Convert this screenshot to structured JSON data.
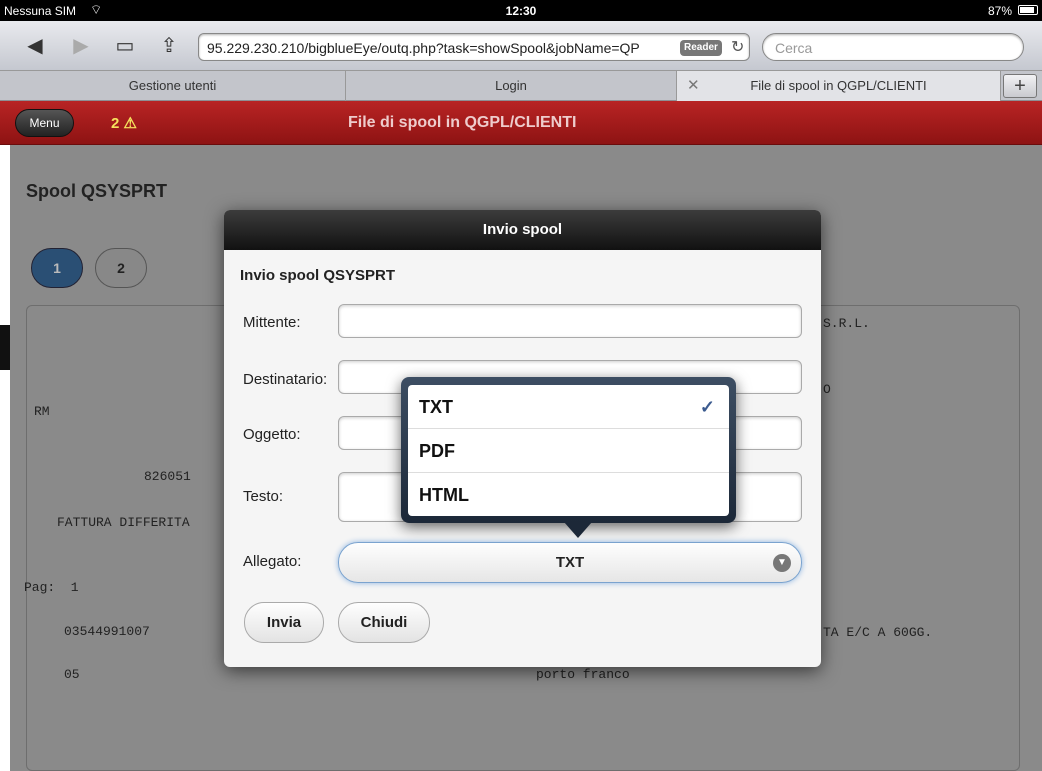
{
  "statusbar": {
    "carrier": "Nessuna SIM",
    "clock": "12:30",
    "battery": "87%"
  },
  "toolbar": {
    "url": "95.229.230.210/bigblueEye/outq.php?task=showSpool&jobName=QP",
    "reader_label": "Reader",
    "search_placeholder": "Cerca"
  },
  "tabs": [
    {
      "label": "Gestione utenti"
    },
    {
      "label": "Login"
    },
    {
      "label": "File di spool in QGPL/CLIENTI"
    }
  ],
  "header": {
    "menu_label": "Menu",
    "warning_count": "2",
    "title": "File di spool in QGPL/CLIENTI"
  },
  "page": {
    "title": "Spool QSYSPRT",
    "pages": [
      "1",
      "2"
    ],
    "spool_lines": {
      "l1": "S.R.L.",
      "l2": "O",
      "l3": "RM",
      "l4": "826051",
      "l5": "FATTURA DIFFERITA",
      "l6": "Pag:  1",
      "l7": "03544991007",
      "l8": "TA E/C A 60GG.",
      "l9": "05",
      "l10": "porto franco"
    }
  },
  "modal": {
    "title": "Invio spool",
    "subtitle": "Invio spool QSYSPRT",
    "fields": {
      "mittente": "Mittente:",
      "destinatario": "Destinatario:",
      "oggetto": "Oggetto:",
      "testo": "Testo:",
      "allegato": "Allegato:"
    },
    "allegato_value": "TXT",
    "send_label": "Invia",
    "close_label": "Chiudi"
  },
  "popover": {
    "options": [
      {
        "label": "TXT",
        "selected": true
      },
      {
        "label": "PDF",
        "selected": false
      },
      {
        "label": "HTML",
        "selected": false
      }
    ],
    "check_glyph": "✓"
  }
}
